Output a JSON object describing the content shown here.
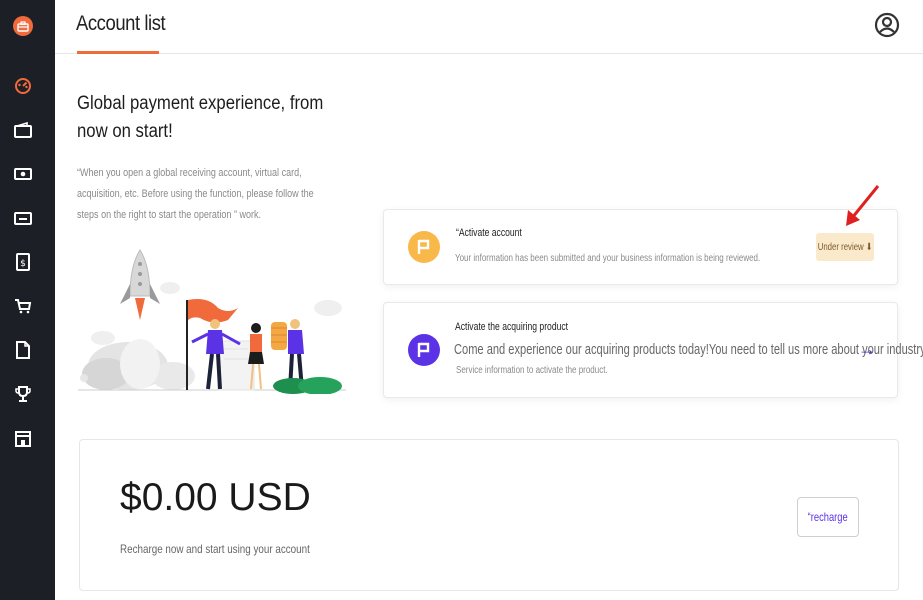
{
  "sidebar": {
    "logo_icon": "briefcase-icon",
    "items": [
      {
        "icon": "dashboard-gauge-icon",
        "active": true
      },
      {
        "icon": "wallet-icon"
      },
      {
        "icon": "cash-icon"
      },
      {
        "icon": "card-icon"
      },
      {
        "icon": "dollar-document-icon"
      },
      {
        "icon": "cart-icon"
      },
      {
        "icon": "document-icon"
      },
      {
        "icon": "trophy-icon"
      },
      {
        "icon": "store-icon"
      }
    ]
  },
  "header": {
    "title": "Account list",
    "user_icon": "user-circle-icon"
  },
  "hero": {
    "title": "Global payment experience, from now on start!",
    "description": "“When you open a global receiving account, virtual card, acquisition, etc. Before using the function, please follow the steps on the right to start the operation ” work."
  },
  "steps": [
    {
      "icon": "flag-icon",
      "title": "“Activate account",
      "description": "Your information has been submitted and your business information is being reviewed.",
      "status_label": "Under review ⬇"
    },
    {
      "icon": "flag-icon",
      "title": "Activate the acquiring product",
      "headline": "Come and experience our acquiring products today!You need to tell us more about your industry",
      "description": "Service information to activate the product.",
      "action_icon": "arrow-right-icon"
    }
  ],
  "balance": {
    "amount": "$0.00 USD",
    "description": "Recharge now and start using your account",
    "recharge_label": "“recharge"
  },
  "colors": {
    "accent": "#f06a3c",
    "primary": "#5b32e6",
    "sidebar_bg": "#1c1f26",
    "pending_badge": "#fbe9cb",
    "step1_icon": "#f9b84a"
  }
}
